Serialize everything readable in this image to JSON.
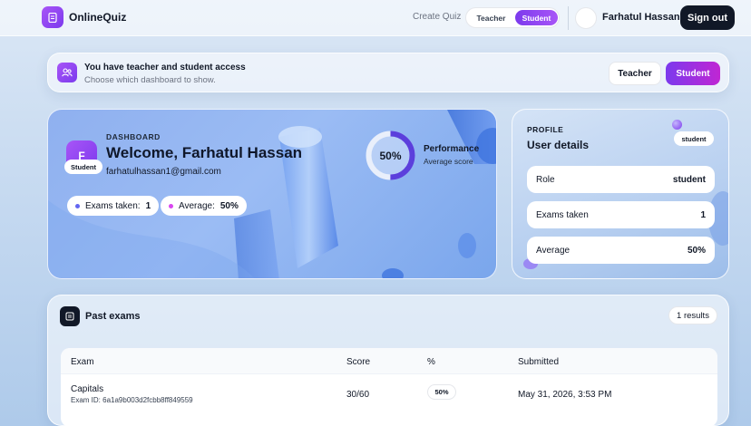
{
  "brand": {
    "name": "OnlineQuiz",
    "logo_icon": "document-icon"
  },
  "nav": {
    "create_quiz": "Create Quiz",
    "toggle": {
      "teacher": "Teacher",
      "student": "Student",
      "selected": "Student"
    },
    "user_name": "Farhatul Hassan",
    "sign_out": "Sign out"
  },
  "access": {
    "title": "You have teacher and student access",
    "subtitle": "Choose which dashboard to show.",
    "teacher_button": "Teacher",
    "student_button": "Student"
  },
  "dashboard": {
    "label": "DASHBOARD",
    "avatar_initial": "F",
    "role_badge": "Student",
    "welcome": "Welcome, Farhatul Hassan",
    "email": "farhatulhassan1@gmail.com",
    "exams_taken_label": "Exams taken:",
    "exams_taken_value": "1",
    "average_label": "Average:",
    "average_value": "50%",
    "performance_percent": "50%",
    "performance_fraction": 0.5,
    "performance_title": "Performance",
    "performance_subtitle": "Average score"
  },
  "profile": {
    "label": "PROFILE",
    "title": "User details",
    "badge": "student",
    "rows": [
      {
        "label": "Role",
        "value": "student"
      },
      {
        "label": "Exams taken",
        "value": "1"
      },
      {
        "label": "Average",
        "value": "50%"
      }
    ]
  },
  "past_exams": {
    "title": "Past exams",
    "results": "1 results",
    "columns": [
      "Exam",
      "Score",
      "%",
      "Submitted"
    ],
    "rows": [
      {
        "exam": "Capitals",
        "exam_id": "Exam ID: 6a1a9b003d2fcbb8ff849559",
        "score": "30/60",
        "percent": "50%",
        "submitted": "May 31, 2026, 3:53 PM"
      }
    ]
  },
  "colors": {
    "accent_purple": "#7c3aed",
    "accent_magenta": "#c026d3",
    "dark": "#111827"
  }
}
